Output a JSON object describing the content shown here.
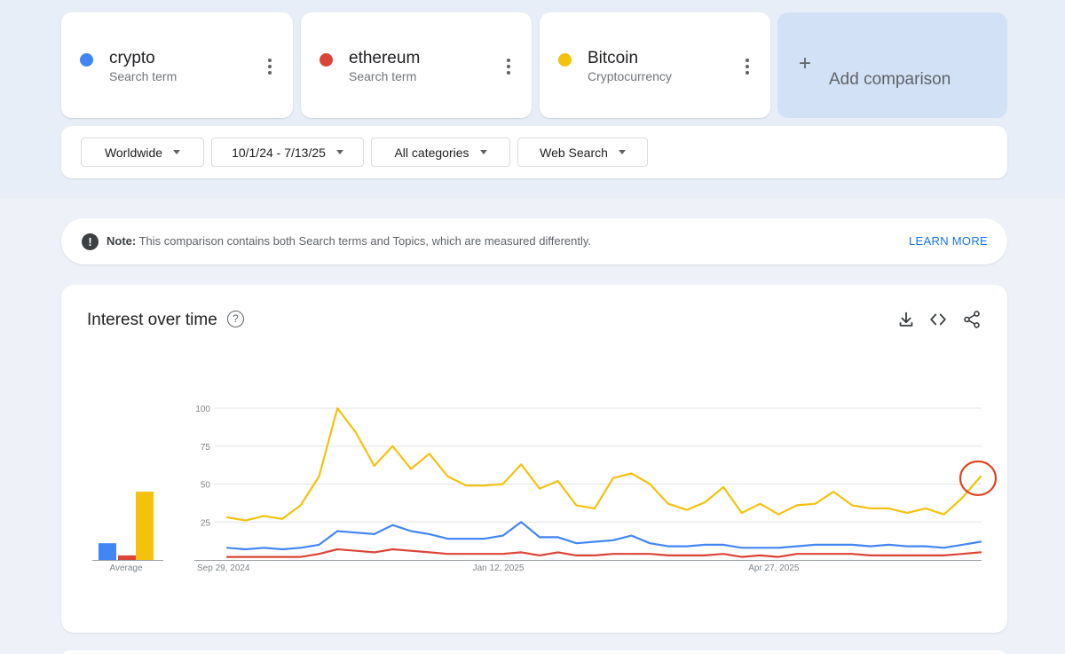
{
  "terms": [
    {
      "name": "crypto",
      "type": "Search term",
      "color": "#4285f4"
    },
    {
      "name": "ethereum",
      "type": "Search term",
      "color": "#db4437"
    },
    {
      "name": "Bitcoin",
      "type": "Cryptocurrency",
      "color": "#f4c20d"
    }
  ],
  "add_comparison": {
    "plus": "+",
    "label": "Add comparison"
  },
  "filters": {
    "region": "Worldwide",
    "date_range": "10/1/24 - 7/13/25",
    "category": "All categories",
    "property": "Web Search"
  },
  "note": {
    "icon": "!",
    "label": "Note:",
    "text": " This comparison contains both Search terms and Topics, which are measured differently.",
    "link": "LEARN MORE"
  },
  "chart_card": {
    "title": "Interest over time",
    "help_icon": "?",
    "actions": [
      "download-icon",
      "embed-icon",
      "share-icon"
    ]
  },
  "chart_data": {
    "type": "line",
    "title": "Interest over time",
    "ylim": [
      0,
      100
    ],
    "y_ticks": [
      "100",
      "75",
      "50",
      "25"
    ],
    "x_tick_labels": [
      "Sep 29, 2024",
      "Jan 12, 2025",
      "Apr 27, 2025"
    ],
    "x_tick_index": [
      0,
      15,
      30
    ],
    "grid": true,
    "averages_label": "Average",
    "averages": [
      {
        "name": "crypto",
        "value": 11,
        "color": "#4285f4"
      },
      {
        "name": "ethereum",
        "value": 3,
        "color": "#db4437"
      },
      {
        "name": "Bitcoin",
        "value": 45,
        "color": "#f4c20d"
      }
    ],
    "series": [
      {
        "name": "crypto",
        "color": "#4285f4",
        "values": [
          8,
          7,
          8,
          7,
          8,
          10,
          19,
          18,
          17,
          23,
          19,
          17,
          14,
          14,
          14,
          16,
          25,
          15,
          15,
          11,
          12,
          13,
          16,
          11,
          9,
          9,
          10,
          10,
          8,
          8,
          8,
          9,
          10,
          10,
          10,
          9,
          10,
          9,
          9,
          8,
          10,
          12
        ]
      },
      {
        "name": "ethereum",
        "color": "#db4437",
        "values": [
          2,
          2,
          2,
          2,
          2,
          4,
          7,
          6,
          5,
          7,
          6,
          5,
          4,
          4,
          4,
          4,
          5,
          3,
          5,
          3,
          3,
          4,
          4,
          4,
          3,
          3,
          3,
          4,
          2,
          3,
          2,
          4,
          4,
          4,
          4,
          3,
          3,
          3,
          3,
          3,
          4,
          5
        ]
      },
      {
        "name": "Bitcoin",
        "color": "#f4c20d",
        "values": [
          28,
          26,
          29,
          27,
          36,
          55,
          100,
          84,
          62,
          75,
          60,
          70,
          55,
          49,
          49,
          50,
          63,
          47,
          52,
          36,
          34,
          54,
          57,
          50,
          37,
          33,
          38,
          48,
          31,
          37,
          30,
          36,
          37,
          45,
          36,
          34,
          34,
          31,
          34,
          30,
          41,
          55
        ]
      }
    ],
    "annotation": {
      "type": "circle",
      "series": "Bitcoin",
      "point_index": 41,
      "color": "#e0411c"
    }
  }
}
